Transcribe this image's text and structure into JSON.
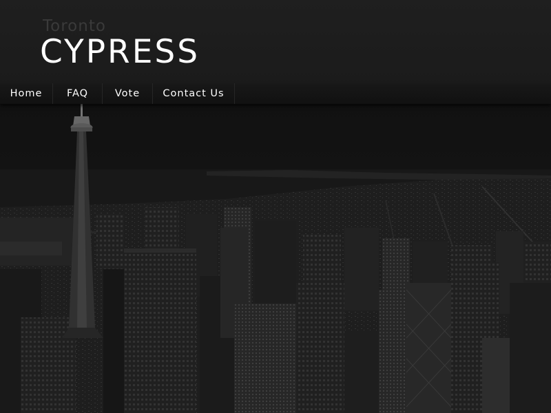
{
  "header": {
    "subtitle": "Toronto",
    "title": "CYPRESS"
  },
  "nav": {
    "items": [
      {
        "label": "Home"
      },
      {
        "label": "FAQ"
      },
      {
        "label": "Vote"
      },
      {
        "label": "Contact Us"
      }
    ]
  },
  "hero": {
    "image": "toronto-skyline-night-photo"
  },
  "colors": {
    "background": "#1c1c1c",
    "title": "#ffffff",
    "subtitle": "#3a3a3a",
    "nav_bar": "#141414"
  }
}
